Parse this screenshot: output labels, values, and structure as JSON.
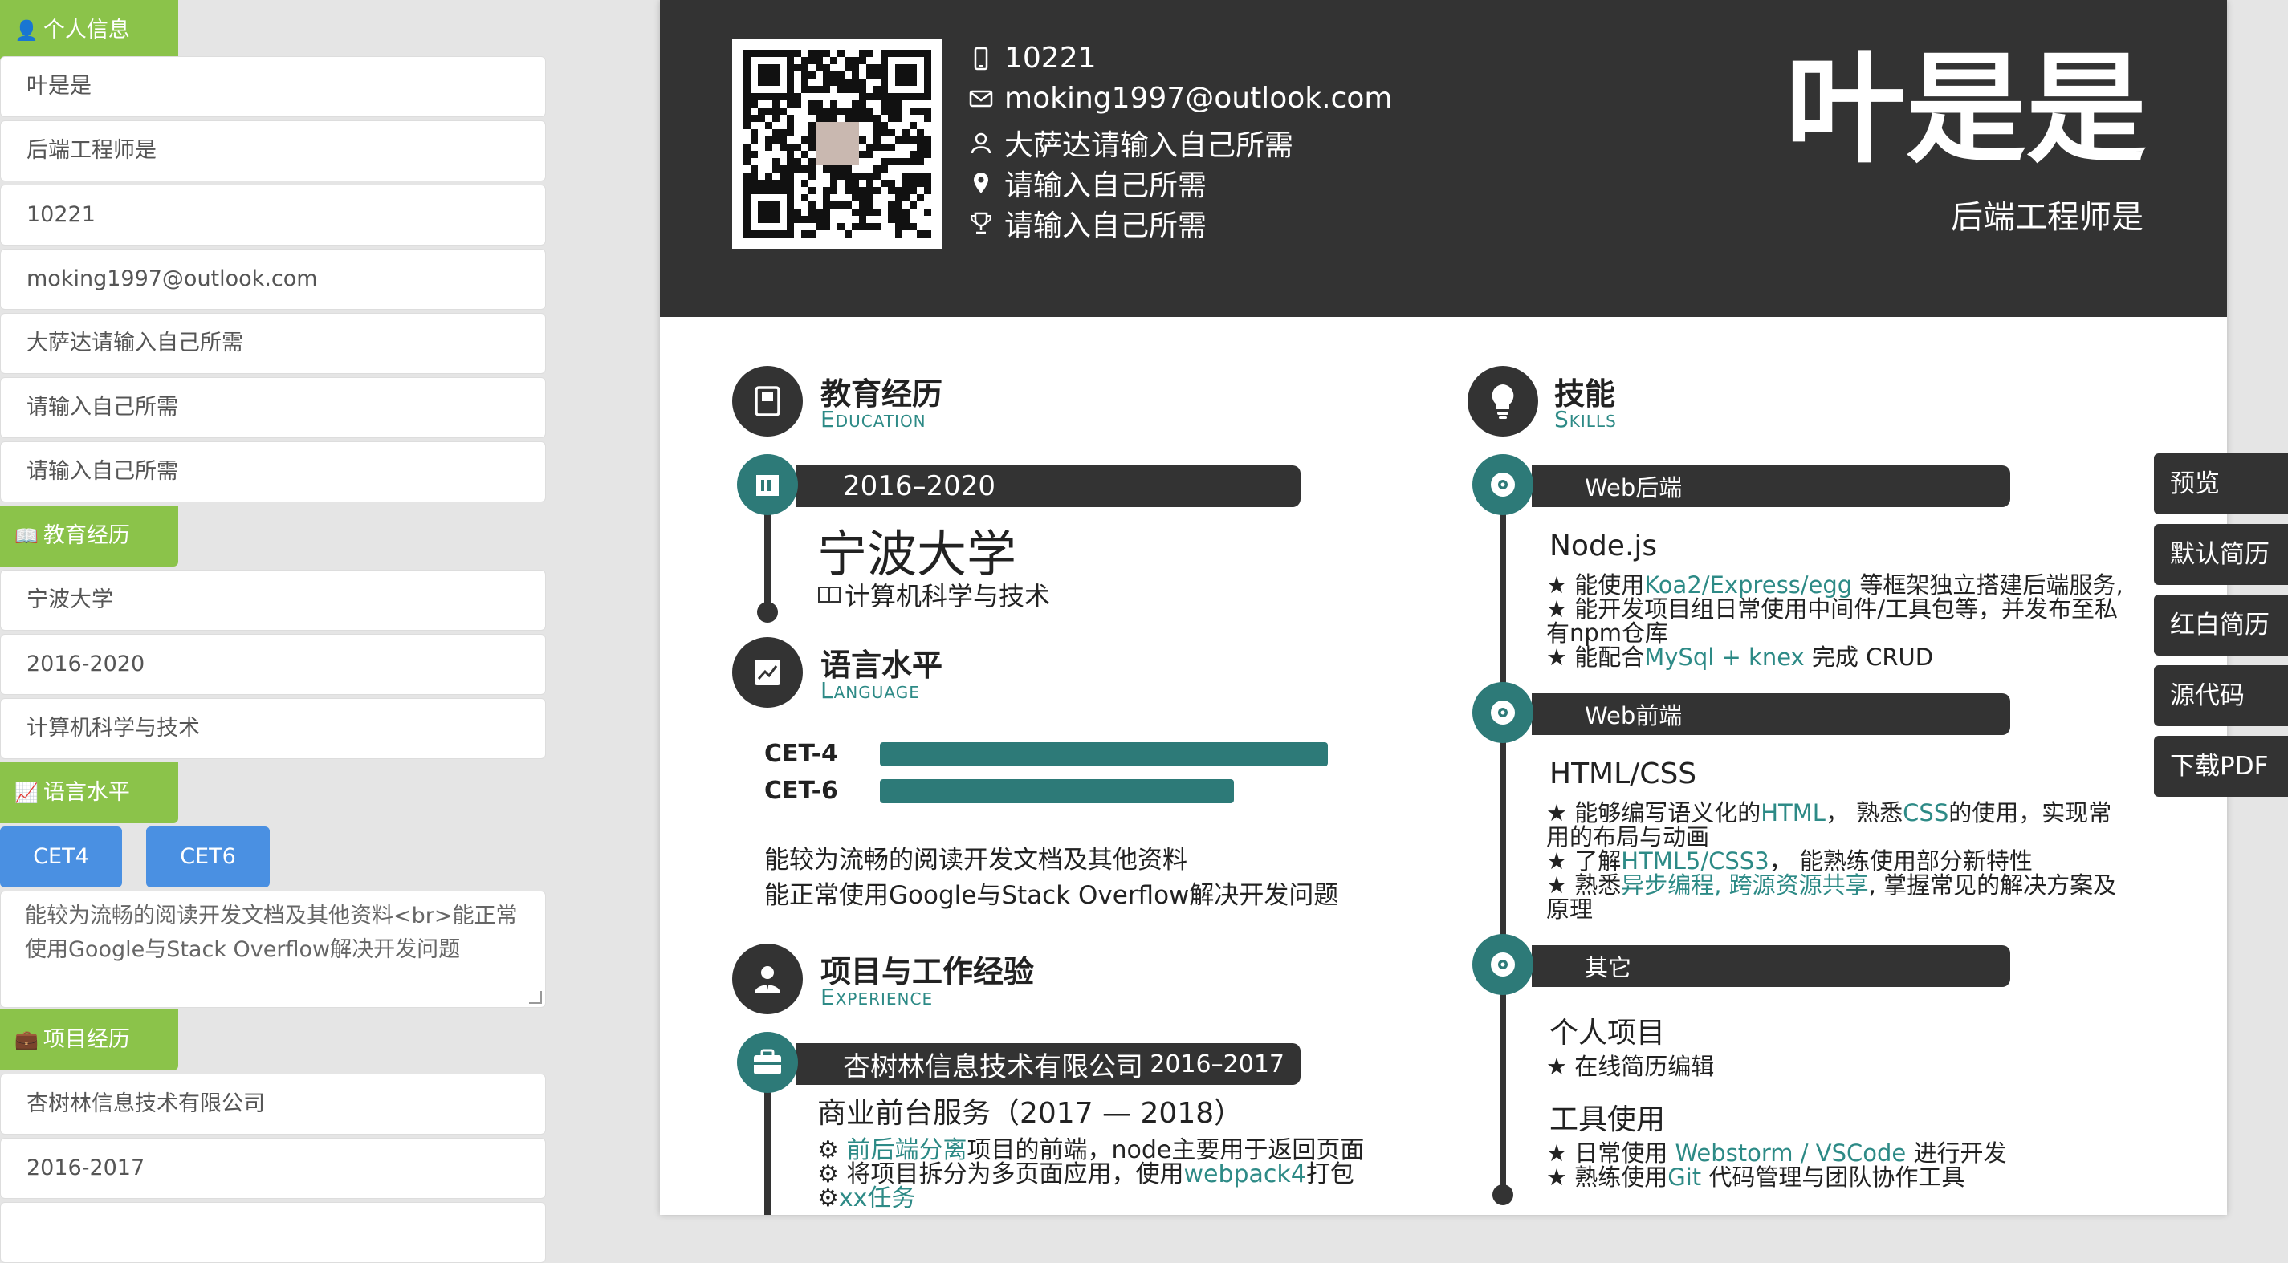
{
  "editor": {
    "personal_heading": "个人信息",
    "name_value": "叶是是",
    "role_value": "后端工程师是",
    "phone_value": "10221",
    "email_value": "moking1997@outlook.com",
    "field5_value": "大萨达请输入自己所需",
    "field6_value": "请输入自己所需",
    "field7_value": "请输入自己所需",
    "education_heading": "教育经历",
    "school_value": " 宁波大学",
    "edu_period_value": "2016-2020",
    "major_value": "计算机科学与技术",
    "language_heading": "语言水平",
    "tags": [
      "CET4",
      "CET6"
    ],
    "language_desc_value": "能较为流畅的阅读开发文档及其他资料<br>能正常使用Google与Stack Overflow解决开发问题",
    "project_heading": "项目经历",
    "company_value": "杏树林信息技术有限公司",
    "job_period_value": "2016-2017"
  },
  "resume": {
    "header": {
      "phone": "10221",
      "email": "moking1997@outlook.com",
      "line3": "大萨达请输入自己所需",
      "line4": "请输入自己所需",
      "line5": "请输入自己所需",
      "name": "叶是是",
      "role": "后端工程师是"
    },
    "education": {
      "title": "教育经历",
      "subtitle": "Education",
      "period": "2016–2020",
      "school": "宁波大学",
      "major": "计算机科学与技术"
    },
    "language": {
      "title": "语言水平",
      "subtitle": "Language",
      "levels": [
        {
          "name": "CET-4",
          "value": 1.0
        },
        {
          "name": "CET-6",
          "value": 0.79
        }
      ],
      "line1": "能较为流畅的阅读开发文档及其他资料",
      "line2": "能正常使用Google与Stack Overflow解决开发问题"
    },
    "experience": {
      "title": "项目与工作经验",
      "subtitle": "Experience",
      "company": "杏树林信息技术有限公司",
      "period": "2016–2017",
      "project_title": "商业前台服务（2017 — 2018）",
      "item1_hl": "前后端分离",
      "item1_rest": "项目的前端，node主要用于返回页面",
      "item2_pre": "将项目拆分为多页面应用，使用",
      "item2_hl": "webpack4",
      "item2_post": "打包",
      "item3_hl": "xx任务"
    },
    "skills": {
      "title": "技能",
      "subtitle": "Skills",
      "group1": "Web后端",
      "g1_heading": "Node.js",
      "g1_l1_pre": "能使用",
      "g1_l1_hl": "Koa2/Express/egg",
      "g1_l1_post": " 等框架独立搭建后端服务,",
      "g1_l2a": "能开发项目组日常使用中间件/工具包等，并发布至私",
      "g1_l2b": "有npm仓库",
      "g1_l3_pre": "能配合",
      "g1_l3_hl": "MySql + knex",
      "g1_l3_post": " 完成 CRUD",
      "group2": "Web前端",
      "g2_heading": "HTML/CSS",
      "g2_l1_pre": "能够编写语义化的",
      "g2_l1_hl1": "HTML",
      "g2_l1_mid": "， 熟悉",
      "g2_l1_hl2": "CSS",
      "g2_l1_post": "的使用，实现常",
      "g2_l1b": "用的布局与动画",
      "g2_l2_pre": "了解",
      "g2_l2_hl": "HTML5/CSS3",
      "g2_l2_post": "， 能熟练使用部分新特性",
      "g2_l3_pre": "熟悉",
      "g2_l3_hl": "异步编程, 跨源资源共享",
      "g2_l3_post": ", 掌握常见的解决方案及",
      "g2_l3b": "原理",
      "group3": "其它",
      "g3_heading1": "个人项目",
      "g3_l1": "在线简历编辑",
      "g3_heading2": "工具使用",
      "g3_l2_pre": "日常使用 ",
      "g3_l2_hl": "Webstorm / VSCode",
      "g3_l2_post": " 进行开发",
      "g3_l3_pre": "熟练使用",
      "g3_l3_hl": "Git",
      "g3_l3_post": " 代码管理与团队协作工具"
    }
  },
  "menu": {
    "preview": "预览",
    "default_resume": "默认简历",
    "red_white_resume": "红白简历",
    "source_code": "源代码",
    "download_pdf": "下载PDF"
  }
}
